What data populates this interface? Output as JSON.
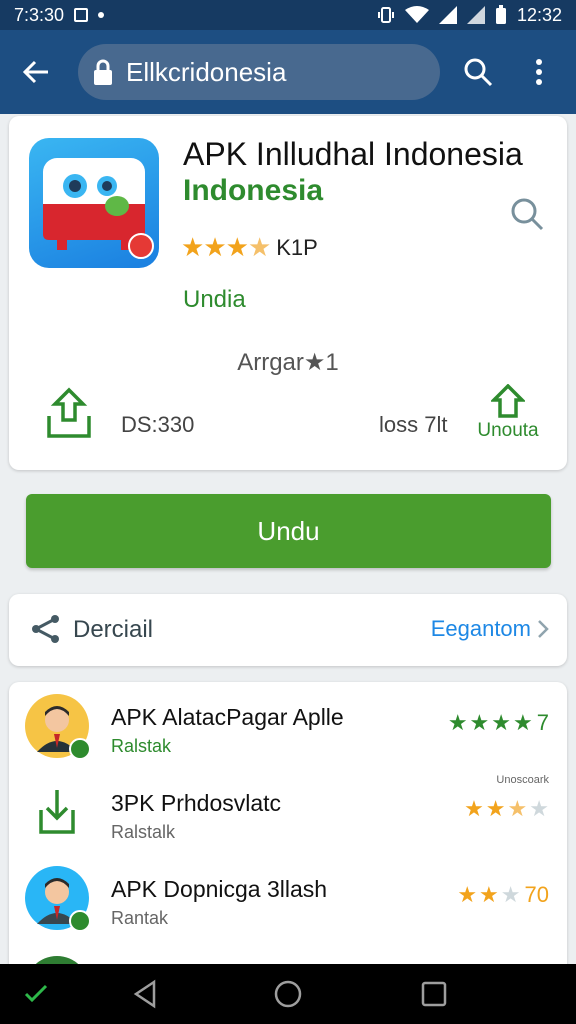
{
  "status_bar": {
    "time_left": "7:3:30",
    "time_right": "12:32"
  },
  "address_bar": {
    "url": "Ellkcridonesia"
  },
  "app": {
    "title": "APK Inlludhal Indonesia",
    "subtitle": "Indonesia",
    "rating": 3.5,
    "rating_text": "K1P",
    "install_label": "Undia",
    "arrange_label": "Arrgar★1",
    "size_left": "DS:330",
    "size_right": "loss 7lt",
    "home_action_label": "Unouta"
  },
  "download_button": {
    "label": "Undu"
  },
  "detail": {
    "label": "Derciail",
    "link": "Eegantom"
  },
  "related": [
    {
      "title": "APK AlatacPagar Aplle",
      "sub": "Ralstak",
      "stars": [
        1,
        1,
        1,
        0.5
      ],
      "star_color": "green",
      "score": "7"
    },
    {
      "title": "3PK Prhdosvlatc",
      "sub": "Ralstalk",
      "stars": [
        1,
        1,
        0.5,
        0,
        0
      ],
      "star_color": "orange",
      "score": "",
      "tag": "Unoscoark"
    },
    {
      "title": "APK Dopnicga 3llash",
      "sub": "Rantak",
      "stars": [
        1,
        1,
        0
      ],
      "star_color": "orange",
      "score": "70"
    }
  ],
  "colors": {
    "status_bar": "#163a62",
    "app_bar": "#1d4e82",
    "accent_green": "#4a9d2e",
    "link_blue": "#1e88e5",
    "star_orange": "#f2a31c"
  }
}
